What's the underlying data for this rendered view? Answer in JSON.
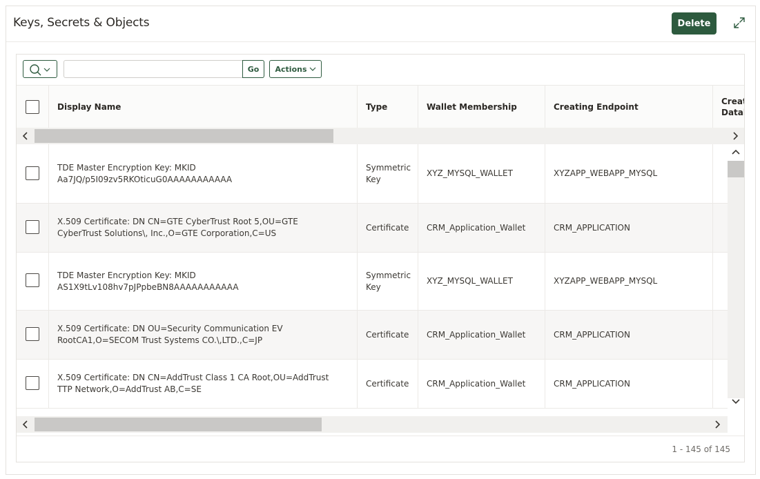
{
  "region": {
    "title": "Keys, Secrets & Objects",
    "delete_label": "Delete"
  },
  "toolbar": {
    "search_placeholder": "",
    "go_label": "Go",
    "actions_label": "Actions"
  },
  "columns": [
    "Display Name",
    "Type",
    "Wallet Membership",
    "Creating Endpoint",
    "Creating Database"
  ],
  "rows": [
    {
      "display_name": "TDE Master Encryption Key: MKID Aa7JQ/p5I09zv5RKOticuG0AAAAAAAAAAA",
      "type": "Symmetric Key",
      "wallet": "XYZ_MYSQL_WALLET",
      "endpoint": "XYZAPP_WEBAPP_MYSQL"
    },
    {
      "display_name": "X.509 Certificate: DN CN=GTE CyberTrust Root 5,OU=GTE CyberTrust Solutions\\, Inc.,O=GTE Corporation,C=US",
      "type": "Certificate",
      "wallet": "CRM_Application_Wallet",
      "endpoint": "CRM_APPLICATION"
    },
    {
      "display_name": "TDE Master Encryption Key: MKID AS1X9tLv108hv7pJPpbeBN8AAAAAAAAAAA",
      "type": "Symmetric Key",
      "wallet": "XYZ_MYSQL_WALLET",
      "endpoint": "XYZAPP_WEBAPP_MYSQL"
    },
    {
      "display_name": "X.509 Certificate: DN OU=Security Communication EV RootCA1,O=SECOM Trust Systems CO.\\,LTD.,C=JP",
      "type": "Certificate",
      "wallet": "CRM_Application_Wallet",
      "endpoint": "CRM_APPLICATION"
    },
    {
      "display_name": "X.509 Certificate: DN CN=AddTrust Class 1 CA Root,OU=AddTrust TTP Network,O=AddTrust AB,C=SE",
      "type": "Certificate",
      "wallet": "CRM_Application_Wallet",
      "endpoint": "CRM_APPLICATION"
    }
  ],
  "pagination": {
    "label": "1 - 145 of 145"
  },
  "colors": {
    "accent": "#2d5a3e",
    "row_alt": "#f7f6f5"
  }
}
